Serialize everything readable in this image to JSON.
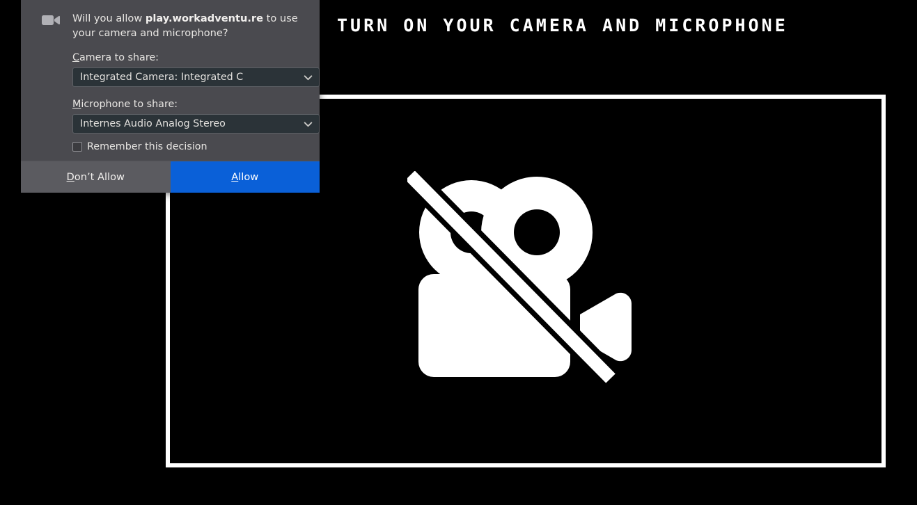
{
  "page": {
    "background_color": "#000000",
    "title": "TURN ON YOUR CAMERA AND MICROPHONE",
    "video_preview": {
      "name": "camera-preview",
      "border_color": "#ffffff",
      "background_color": "#000000",
      "icon": "camera-off-icon",
      "icon_color": "#ffffff",
      "state_label": "camera disabled"
    }
  },
  "dialog": {
    "name": "camera-microphone-permission-dialog",
    "icon": "camera-icon",
    "background_color": "#4a4a4f",
    "question_prefix": "Will you allow ",
    "host": "play.workadventu.re",
    "question_suffix": " to use your camera and microphone?",
    "camera": {
      "label_accesskey": "C",
      "label_rest": "amera to share:",
      "selected": "Integrated Camera: Integrated C",
      "chevron": "chevron-down-icon"
    },
    "microphone": {
      "label_accesskey": "M",
      "label_rest": "icrophone to share:",
      "selected": "Internes Audio Analog Stereo",
      "chevron": "chevron-down-icon"
    },
    "remember": {
      "label": "Remember this decision",
      "checked": false
    },
    "buttons": {
      "deny": {
        "accesskey": "D",
        "rest": "on’t Allow",
        "color": "#5b5b60"
      },
      "allow": {
        "accesskey": "A",
        "rest": "llow",
        "color": "#0a60d8"
      }
    }
  }
}
